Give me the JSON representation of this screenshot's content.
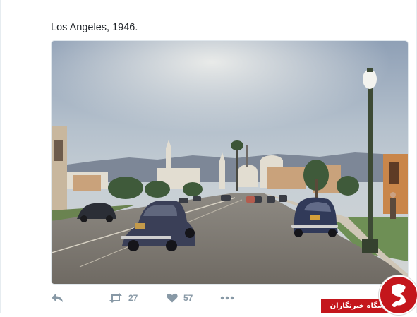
{
  "tweet": {
    "text": "Los Angeles, 1946."
  },
  "media": {
    "alt": "Vintage color photograph of a Los Angeles street in 1946"
  },
  "actions": {
    "reply_icon": "reply-icon",
    "retweet_icon": "retweet-icon",
    "retweet_count": "27",
    "like_icon": "heart-icon",
    "like_count": "57",
    "more_icon": "more-icon"
  },
  "watermark": {
    "label": "باشگاه خبرنگاران",
    "logo_icon": "news-agency-logo"
  },
  "colors": {
    "action_gray": "#8899a6",
    "watermark_red": "#c4161c",
    "border": "#e1e8ed"
  }
}
